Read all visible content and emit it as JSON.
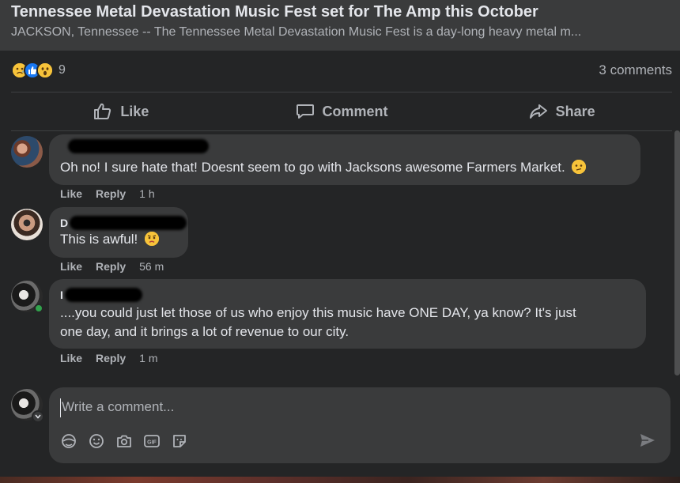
{
  "link_preview": {
    "title": "Tennessee Metal Devastation Music Fest set for The Amp this October",
    "description": "JACKSON, Tennessee -- The Tennessee Metal Devastation Music Fest is a day-long heavy metal m..."
  },
  "reactions": {
    "icons": [
      "sad-icon",
      "like-icon",
      "wow-icon"
    ],
    "count": "9",
    "comments_count": "3 comments"
  },
  "actions": {
    "like": "Like",
    "comment": "Comment",
    "share": "Share"
  },
  "comments": [
    {
      "author_initial": "",
      "text": "Oh no! I sure hate that! Doesnt seem to go with Jacksons awesome Farmers Market.",
      "emoji": "confused-emoji",
      "like": "Like",
      "reply": "Reply",
      "time": "1 h"
    },
    {
      "author_initial": "D",
      "text": "This is awful!",
      "emoji": "worried-emoji",
      "like": "Like",
      "reply": "Reply",
      "time": "56 m"
    },
    {
      "author_initial": "I",
      "text_line1": "....you could just let those of us who enjoy this music have ONE DAY, ya know? It's just",
      "text_line2": "one day, and it brings a lot of revenue to our city.",
      "like": "Like",
      "reply": "Reply",
      "time": "1 m"
    }
  ],
  "composer": {
    "placeholder": "Write a comment...",
    "tools": [
      "avatar-sticker-icon",
      "emoji-icon",
      "camera-icon",
      "gif-icon",
      "sticker-icon"
    ],
    "send_icon": "send-icon"
  },
  "colors": {
    "background": "#242526",
    "bubble": "#3a3b3c",
    "text_primary": "#e4e6eb",
    "text_secondary": "#b0b3b8",
    "like_blue": "#1877f2",
    "reaction_yellow": "#f7c33a",
    "online_green": "#31a24c"
  }
}
